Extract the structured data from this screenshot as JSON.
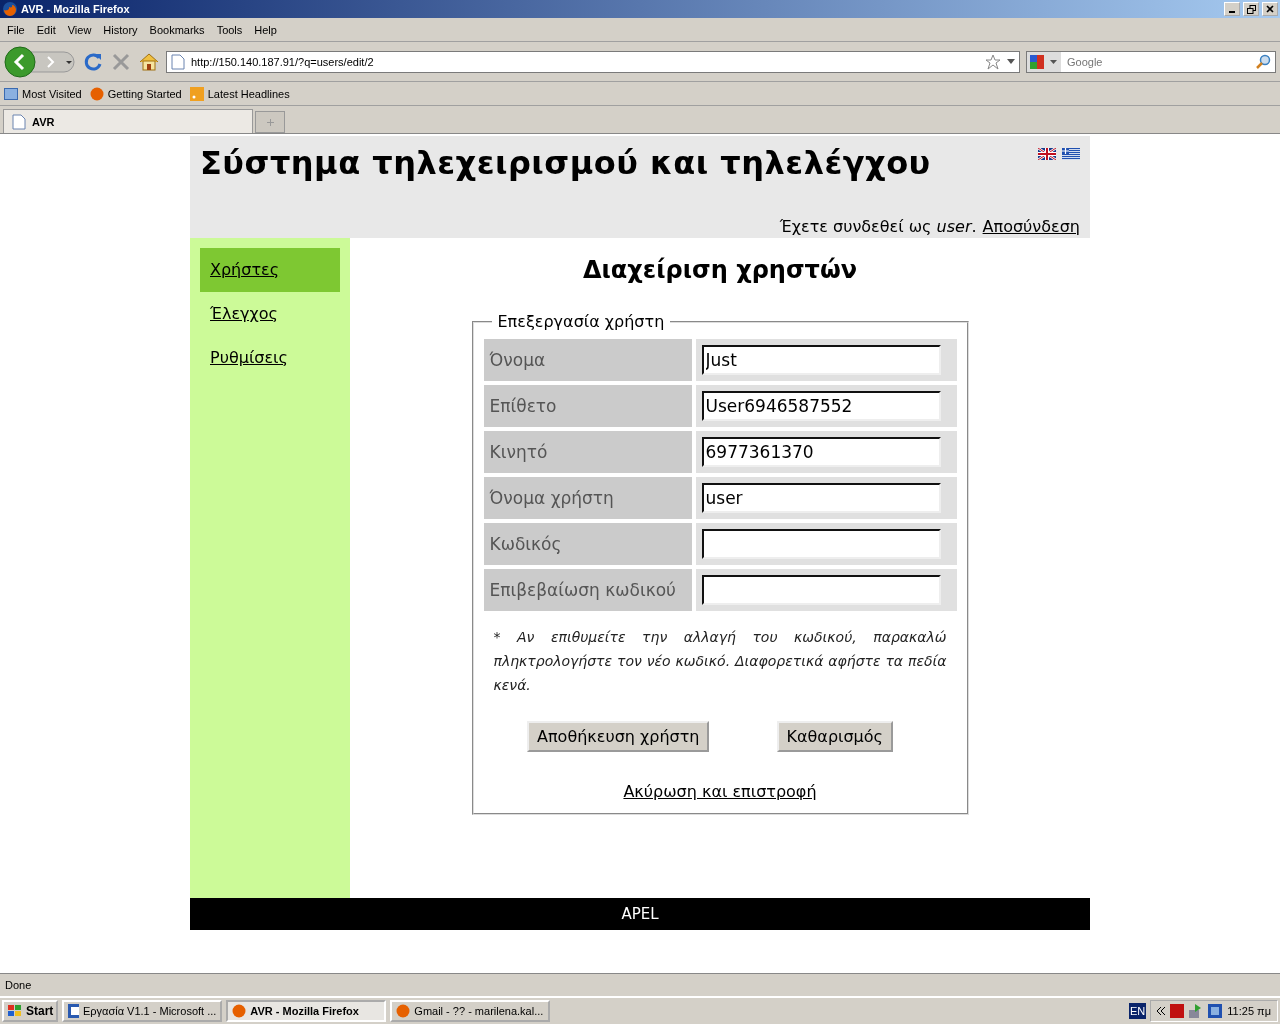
{
  "window": {
    "title": "AVR - Mozilla Firefox"
  },
  "menu": [
    "File",
    "Edit",
    "View",
    "History",
    "Bookmarks",
    "Tools",
    "Help"
  ],
  "address": {
    "value": "http://150.140.187.91/?q=users/edit/2"
  },
  "search": {
    "placeholder": "Google"
  },
  "bookmarks": [
    "Most Visited",
    "Getting Started",
    "Latest Headlines"
  ],
  "tabs": [
    {
      "label": "AVR",
      "selected": true
    }
  ],
  "page": {
    "title": "Σύστημα τηλεχειρισμού και τηλελέγχου",
    "login_text": "Έχετε συνδεθεί ως *user*.",
    "logout": "Αποσύνδεση",
    "sidebar": [
      {
        "label": "Χρήστες",
        "selected": true
      },
      {
        "label": "Έλεγχος",
        "selected": false
      },
      {
        "label": "Ρυθμίσεις",
        "selected": false
      }
    ],
    "heading": "Διαχείριση χρηστών",
    "legend": "Επεξεργασία χρήστη",
    "fields": [
      {
        "label": "Όνομα",
        "value": "Just"
      },
      {
        "label": "Επίθετο",
        "value": "User6946587552"
      },
      {
        "label": "Κινητό",
        "value": "6977361370"
      },
      {
        "label": "Όνομα χρήστη",
        "value": "user"
      },
      {
        "label": "Κωδικός"
      },
      {
        "label": "Επιβεβαίωση κωδικού"
      }
    ],
    "note": "* Αν επιθυμείτε την αλλαγή του κωδικού, παρακαλώ πληκτρολογήστε τον νέο κωδικό. Διαφορετικά αφήστε τα πεδία κενά.",
    "buttons": [
      "Αποθήκευση χρήστη",
      "Καθαρισμός"
    ],
    "cancel": "Ακύρωση και επιστροφή",
    "footer": "APEL"
  },
  "status_bar": "Done",
  "taskbar": {
    "start": "Start",
    "tasks": [
      {
        "label": "Εργασία V1.1 - Microsoft ...",
        "selected": false
      },
      {
        "label": "AVR - Mozilla Firefox",
        "selected": true
      },
      {
        "label": "Gmail - ?? - marilena.kal...",
        "selected": false
      }
    ],
    "language": "EN",
    "clock": "11:25 πμ"
  }
}
